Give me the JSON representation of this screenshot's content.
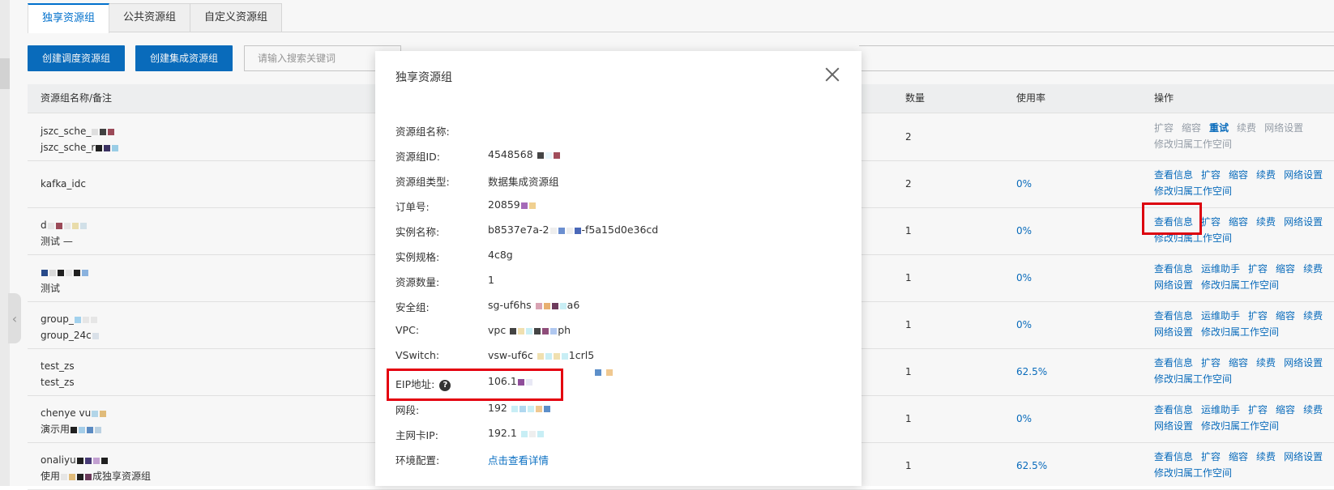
{
  "tabs": [
    {
      "label": "独享资源组",
      "active": true
    },
    {
      "label": "公共资源组",
      "active": false
    },
    {
      "label": "自定义资源组",
      "active": false
    }
  ],
  "toolbar": {
    "create_schedule_label": "创建调度资源组",
    "create_integration_label": "创建集成资源组",
    "search_placeholder": "请输入搜索关键词"
  },
  "table": {
    "headers": {
      "name": "资源组名称/备注",
      "quantity": "数量",
      "usage": "使用率",
      "actions": "操作"
    },
    "rows": [
      {
        "name_line1": "jszc_sche_",
        "name_line2": "jszc_sche_r",
        "quantity": "2",
        "usage": "",
        "ops_line1": [
          "扩容",
          "缩容",
          "重试",
          "续费",
          "网络设置"
        ],
        "ops_line2": [
          "修改归属工作空间"
        ],
        "disabled": true
      },
      {
        "name_line1": "kafka_idc",
        "name_line2": "",
        "quantity": "2",
        "usage": "0%",
        "ops_line1": [
          "查看信息",
          "扩容",
          "缩容",
          "续费",
          "网络设置"
        ],
        "ops_line2": [
          "修改归属工作空间"
        ],
        "disabled": false
      },
      {
        "name_line1": "d",
        "name_line2": "测试   —",
        "quantity": "1",
        "usage": "0%",
        "ops_line1": [
          "查看信息",
          "扩容",
          "缩容",
          "续费",
          "网络设置"
        ],
        "ops_line2": [
          "修改归属工作空间"
        ],
        "disabled": false
      },
      {
        "name_line1": "",
        "name_line2": "测试",
        "quantity": "1",
        "usage": "0%",
        "ops_line1": [
          "查看信息",
          "运维助手",
          "扩容",
          "缩容",
          "续费"
        ],
        "ops_line2": [
          "网络设置",
          "修改归属工作空间"
        ],
        "disabled": false
      },
      {
        "name_line1": "group_",
        "name_line2": "group_24c",
        "quantity": "1",
        "usage": "0%",
        "ops_line1": [
          "查看信息",
          "运维助手",
          "扩容",
          "缩容",
          "续费"
        ],
        "ops_line2": [
          "网络设置",
          "修改归属工作空间"
        ],
        "disabled": false
      },
      {
        "name_line1": "test_zs",
        "name_line2": "test_zs",
        "quantity": "1",
        "usage": "62.5%",
        "ops_line1": [
          "查看信息",
          "扩容",
          "缩容",
          "续费",
          "网络设置"
        ],
        "ops_line2": [
          "修改归属工作空间"
        ],
        "disabled": false
      },
      {
        "name_line1": "chenye vu",
        "name_line2": "演示用",
        "quantity": "1",
        "usage": "0%",
        "ops_line1": [
          "查看信息",
          "运维助手",
          "扩容",
          "缩容",
          "续费"
        ],
        "ops_line2": [
          "网络设置",
          "修改归属工作空间"
        ],
        "disabled": false
      },
      {
        "name_line1": "onaliyu",
        "name_line2": "使用",
        "name_line2_suffix": "成独享资源组",
        "quantity": "1",
        "usage": "62.5%",
        "ops_line1": [
          "查看信息",
          "扩容",
          "缩容",
          "续费",
          "网络设置"
        ],
        "ops_line2": [
          "修改归属工作空间"
        ],
        "disabled": false
      }
    ]
  },
  "modal": {
    "title": "独享资源组",
    "fields": [
      {
        "label": "资源组名称:",
        "value": ""
      },
      {
        "label": "资源组ID:",
        "value": "4548568"
      },
      {
        "label": "资源组类型:",
        "value": "数据集成资源组"
      },
      {
        "label": "订单号:",
        "value": "20859"
      },
      {
        "label": "实例名称:",
        "value": "b8537e7a-2",
        "value_suffix": "-f5a15d0e36cd"
      },
      {
        "label": "实例规格:",
        "value": "4c8g"
      },
      {
        "label": "资源数量:",
        "value": "1"
      },
      {
        "label": "安全组:",
        "value": "sg-uf6hs",
        "value_suffix": "a6"
      },
      {
        "label": "VPC:",
        "value": "vpc",
        "value_suffix": "ph"
      },
      {
        "label": "VSwitch:",
        "value": "vsw-uf6c",
        "value_suffix": "1crl5"
      },
      {
        "label": "EIP地址:",
        "value": "106.1"
      },
      {
        "label": "网段:",
        "value": "192"
      },
      {
        "label": "主网卡IP:",
        "value": "192.1"
      },
      {
        "label": "环境配置:",
        "value": "点击查看详情"
      }
    ]
  },
  "colors": {
    "accent": "#0a6fc2",
    "highlight": "#e4000f"
  }
}
